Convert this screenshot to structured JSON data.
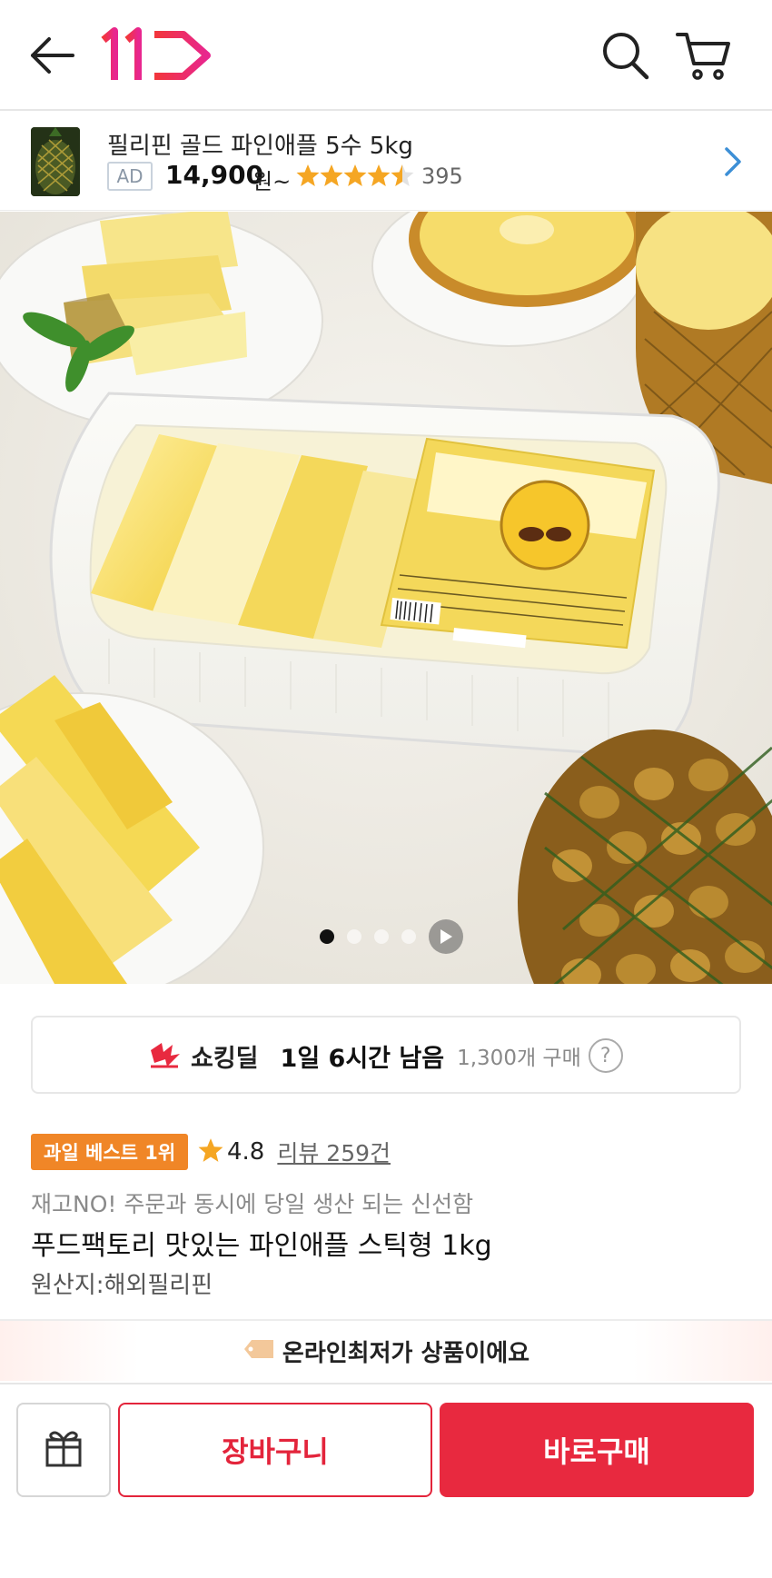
{
  "header": {
    "logo_text": "11",
    "icons": [
      "back-arrow-icon",
      "logo-11st",
      "search-icon",
      "cart-icon"
    ],
    "brand_color": "#e8293f"
  },
  "ad": {
    "title": "필리핀 골드 파인애플 5수 5kg",
    "tag": "AD",
    "price": "14,900",
    "price_unit": "원~",
    "rating": 4.5,
    "review_count": "395"
  },
  "carousel": {
    "total_slides": 4,
    "active_index": 0
  },
  "deal": {
    "label": "쇼킹딜",
    "time_left": "1일 6시간 남음",
    "purchase_count": "1,300개 구매",
    "help": "?"
  },
  "product": {
    "badge": "과일 베스트 1위",
    "rating": "4.8",
    "reviews": "리뷰 259건",
    "subtitle": "재고NO! 주문과 동시에 당일 생산 되는 신선함",
    "title": "푸드팩토리 맛있는 파인애플 스틱형 1kg",
    "origin": "원산지:해외필리핀"
  },
  "lowest_price": {
    "text": "온라인최저가 상품이에요"
  },
  "bottom_bar": {
    "cart_label": "장바구니",
    "buy_label": "바로구매"
  },
  "colors": {
    "accent_red": "#e8293f",
    "badge_orange": "#f08627",
    "star_orange": "#f5a623",
    "link_blue": "#3d8fd6"
  }
}
